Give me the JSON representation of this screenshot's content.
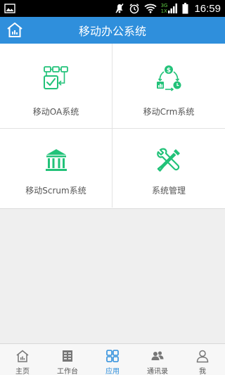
{
  "status_bar": {
    "time": "16:59",
    "network_top": "3G",
    "network_bottom": "1X",
    "icons": [
      "image-icon",
      "mute-icon",
      "alarm-icon",
      "wifi-icon",
      "signal-icon",
      "battery-icon"
    ]
  },
  "header": {
    "title": "移动办公系统",
    "home_icon": "home-icon"
  },
  "apps": [
    {
      "label": "移动OA系统",
      "icon": "oa-workflow-icon"
    },
    {
      "label": "移动Crm系统",
      "icon": "crm-cycle-icon"
    },
    {
      "label": "移动Scrum系统",
      "icon": "bank-columns-icon"
    },
    {
      "label": "系统管理",
      "icon": "tools-icon"
    }
  ],
  "bottom_nav": [
    {
      "label": "主页",
      "icon": "home-icon"
    },
    {
      "label": "工作台",
      "icon": "workbench-icon"
    },
    {
      "label": "应用",
      "icon": "apps-grid-icon",
      "active": true
    },
    {
      "label": "通讯录",
      "icon": "contacts-icon"
    },
    {
      "label": "我",
      "icon": "profile-icon"
    }
  ],
  "colors": {
    "primary": "#2f8fdc",
    "icon_green": "#22c279",
    "nav_inactive": "#777777"
  }
}
